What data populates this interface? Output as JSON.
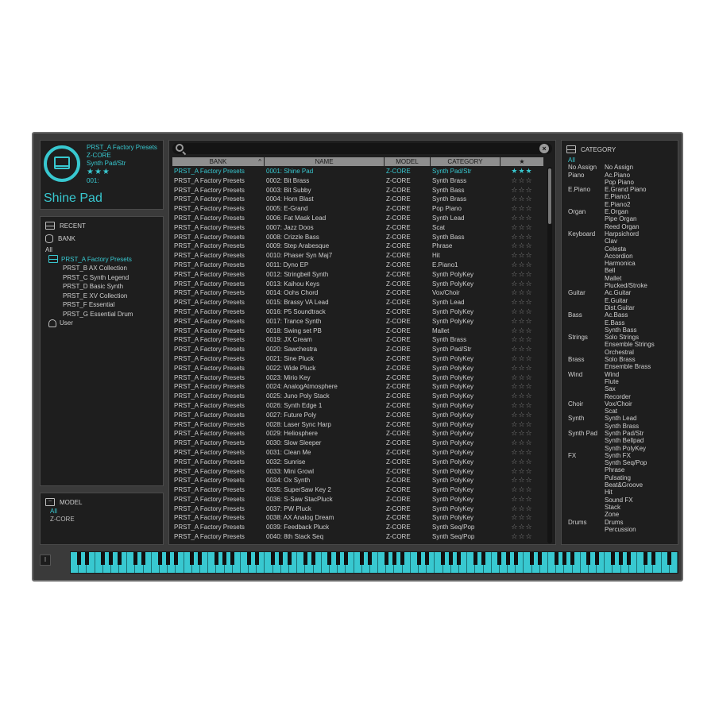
{
  "current": {
    "bank": "PRST_A Factory Presets",
    "model": "Z-CORE",
    "category": "Synth Pad/Str",
    "stars": "★★★",
    "number": "001:",
    "name": "Shine Pad"
  },
  "browser": {
    "recent_label": "RECENT",
    "bank_label": "BANK",
    "all_label": "All",
    "banks": [
      "PRST_A Factory Presets",
      "PRST_B AX Collection",
      "PRST_C Synth Legend",
      "PRST_D Basic Synth",
      "PRST_E XV Collection",
      "PRST_F Essential",
      "PRST_G Essential Drum"
    ],
    "user_label": "User"
  },
  "model_panel": {
    "label": "MODEL",
    "all_label": "All",
    "items": [
      "Z-CORE"
    ]
  },
  "search": {
    "value": "",
    "placeholder": ""
  },
  "table": {
    "columns": [
      "BANK",
      "NAME",
      "MODEL",
      "CATEGORY",
      "★"
    ],
    "rows": [
      [
        "PRST_A Factory Presets",
        "0001: Shine Pad",
        "Z-CORE",
        "Synth Pad/Str",
        "★★★"
      ],
      [
        "PRST_A Factory Presets",
        "0002: Bit Brass",
        "Z-CORE",
        "Synth Brass",
        "☆☆☆"
      ],
      [
        "PRST_A Factory Presets",
        "0003: Bit Subby",
        "Z-CORE",
        "Synth Bass",
        "☆☆☆"
      ],
      [
        "PRST_A Factory Presets",
        "0004: Horn Blast",
        "Z-CORE",
        "Synth Brass",
        "☆☆☆"
      ],
      [
        "PRST_A Factory Presets",
        "0005: E-Grand",
        "Z-CORE",
        "Pop Piano",
        "☆☆☆"
      ],
      [
        "PRST_A Factory Presets",
        "0006: Fat Mask Lead",
        "Z-CORE",
        "Synth Lead",
        "☆☆☆"
      ],
      [
        "PRST_A Factory Presets",
        "0007: Jazz Doos",
        "Z-CORE",
        "Scat",
        "☆☆☆"
      ],
      [
        "PRST_A Factory Presets",
        "0008: Crizzle Bass",
        "Z-CORE",
        "Synth Bass",
        "☆☆☆"
      ],
      [
        "PRST_A Factory Presets",
        "0009: Step Arabesque",
        "Z-CORE",
        "Phrase",
        "☆☆☆"
      ],
      [
        "PRST_A Factory Presets",
        "0010: Phaser Syn Maj7",
        "Z-CORE",
        "Hit",
        "☆☆☆"
      ],
      [
        "PRST_A Factory Presets",
        "0011: Dyno EP",
        "Z-CORE",
        "E.Piano1",
        "☆☆☆"
      ],
      [
        "PRST_A Factory Presets",
        "0012: Stringbell Synth",
        "Z-CORE",
        "Synth PolyKey",
        "☆☆☆"
      ],
      [
        "PRST_A Factory Presets",
        "0013: Kaihou Keys",
        "Z-CORE",
        "Synth PolyKey",
        "☆☆☆"
      ],
      [
        "PRST_A Factory Presets",
        "0014: Oohs Chord",
        "Z-CORE",
        "Vox/Choir",
        "☆☆☆"
      ],
      [
        "PRST_A Factory Presets",
        "0015: Brassy VA Lead",
        "Z-CORE",
        "Synth Lead",
        "☆☆☆"
      ],
      [
        "PRST_A Factory Presets",
        "0016: P5 Soundtrack",
        "Z-CORE",
        "Synth PolyKey",
        "☆☆☆"
      ],
      [
        "PRST_A Factory Presets",
        "0017: Trance Synth",
        "Z-CORE",
        "Synth PolyKey",
        "☆☆☆"
      ],
      [
        "PRST_A Factory Presets",
        "0018: Swing set PB",
        "Z-CORE",
        "Mallet",
        "☆☆☆"
      ],
      [
        "PRST_A Factory Presets",
        "0019: JX Cream",
        "Z-CORE",
        "Synth Brass",
        "☆☆☆"
      ],
      [
        "PRST_A Factory Presets",
        "0020: Sawchestra",
        "Z-CORE",
        "Synth Pad/Str",
        "☆☆☆"
      ],
      [
        "PRST_A Factory Presets",
        "0021: Sine Pluck",
        "Z-CORE",
        "Synth PolyKey",
        "☆☆☆"
      ],
      [
        "PRST_A Factory Presets",
        "0022: Wide Pluck",
        "Z-CORE",
        "Synth PolyKey",
        "☆☆☆"
      ],
      [
        "PRST_A Factory Presets",
        "0023: Mirio Key",
        "Z-CORE",
        "Synth PolyKey",
        "☆☆☆"
      ],
      [
        "PRST_A Factory Presets",
        "0024: AnalogAtmosphere",
        "Z-CORE",
        "Synth PolyKey",
        "☆☆☆"
      ],
      [
        "PRST_A Factory Presets",
        "0025: Juno Poly Stack",
        "Z-CORE",
        "Synth PolyKey",
        "☆☆☆"
      ],
      [
        "PRST_A Factory Presets",
        "0026: Synth Edge 1",
        "Z-CORE",
        "Synth PolyKey",
        "☆☆☆"
      ],
      [
        "PRST_A Factory Presets",
        "0027: Future Poly",
        "Z-CORE",
        "Synth PolyKey",
        "☆☆☆"
      ],
      [
        "PRST_A Factory Presets",
        "0028: Laser Sync Harp",
        "Z-CORE",
        "Synth PolyKey",
        "☆☆☆"
      ],
      [
        "PRST_A Factory Presets",
        "0029: Heliosphere",
        "Z-CORE",
        "Synth PolyKey",
        "☆☆☆"
      ],
      [
        "PRST_A Factory Presets",
        "0030: Slow Sleeper",
        "Z-CORE",
        "Synth PolyKey",
        "☆☆☆"
      ],
      [
        "PRST_A Factory Presets",
        "0031: Clean Me",
        "Z-CORE",
        "Synth PolyKey",
        "☆☆☆"
      ],
      [
        "PRST_A Factory Presets",
        "0032: Sunrise",
        "Z-CORE",
        "Synth PolyKey",
        "☆☆☆"
      ],
      [
        "PRST_A Factory Presets",
        "0033: Mini Growl",
        "Z-CORE",
        "Synth PolyKey",
        "☆☆☆"
      ],
      [
        "PRST_A Factory Presets",
        "0034: Ox Synth",
        "Z-CORE",
        "Synth PolyKey",
        "☆☆☆"
      ],
      [
        "PRST_A Factory Presets",
        "0035: SuperSaw Key 2",
        "Z-CORE",
        "Synth PolyKey",
        "☆☆☆"
      ],
      [
        "PRST_A Factory Presets",
        "0036: S-Saw StacPluck",
        "Z-CORE",
        "Synth PolyKey",
        "☆☆☆"
      ],
      [
        "PRST_A Factory Presets",
        "0037: PW Pluck",
        "Z-CORE",
        "Synth PolyKey",
        "☆☆☆"
      ],
      [
        "PRST_A Factory Presets",
        "0038: AX Analog Dream",
        "Z-CORE",
        "Synth PolyKey",
        "☆☆☆"
      ],
      [
        "PRST_A Factory Presets",
        "0039: Feedback Pluck",
        "Z-CORE",
        "Synth Seq/Pop",
        "☆☆☆"
      ],
      [
        "PRST_A Factory Presets",
        "0040: 8th Stack Seq",
        "Z-CORE",
        "Synth Seq/Pop",
        "☆☆☆"
      ]
    ]
  },
  "category": {
    "label": "CATEGORY",
    "all_label": "All",
    "groups": [
      {
        "name": "No Assign",
        "items": [
          "No Assign"
        ]
      },
      {
        "name": "Piano",
        "items": [
          "Ac.Piano",
          "Pop Piano"
        ]
      },
      {
        "name": "E.Piano",
        "items": [
          "E.Grand Piano",
          "E.Piano1",
          "E.Piano2"
        ]
      },
      {
        "name": "Organ",
        "items": [
          "E.Organ",
          "Pipe Organ",
          "Reed Organ"
        ]
      },
      {
        "name": "Keyboard",
        "items": [
          "Harpsichord",
          "Clav",
          "Celesta",
          "Accordion",
          "Harmonica",
          "Bell",
          "Mallet",
          "Plucked/Stroke"
        ]
      },
      {
        "name": "Guitar",
        "items": [
          "Ac.Guitar",
          "E.Guitar",
          "Dist.Guitar"
        ]
      },
      {
        "name": "Bass",
        "items": [
          "Ac.Bass",
          "E.Bass",
          "Synth Bass"
        ]
      },
      {
        "name": "Strings",
        "items": [
          "Solo Strings",
          "Ensemble Strings",
          "Orchestral"
        ]
      },
      {
        "name": "Brass",
        "items": [
          "Solo Brass",
          "Ensemble Brass"
        ]
      },
      {
        "name": "Wind",
        "items": [
          "Wind",
          "Flute",
          "Sax",
          "Recorder"
        ]
      },
      {
        "name": "Choir",
        "items": [
          "Vox/Choir",
          "Scat"
        ]
      },
      {
        "name": "Synth",
        "items": [
          "Synth Lead",
          "Synth Brass"
        ]
      },
      {
        "name": "Synth Pad",
        "items": [
          "Synth Pad/Str",
          "Synth Bellpad",
          "Synth PolyKey"
        ]
      },
      {
        "name": "FX",
        "items": [
          "Synth FX",
          "Synth Seq/Pop",
          "Phrase",
          "Pulsating",
          "Beat&Groove",
          "Hit",
          "Sound FX",
          "Stack",
          "Zone"
        ]
      },
      {
        "name": "Drums",
        "items": [
          "Drums",
          "Percussion"
        ]
      }
    ]
  },
  "keyboard": {
    "button_label": "I",
    "white_keys": 75
  },
  "colors": {
    "accent": "#38c8d0",
    "panel": "#1e1e1e",
    "frame": "#3a3a3a"
  }
}
